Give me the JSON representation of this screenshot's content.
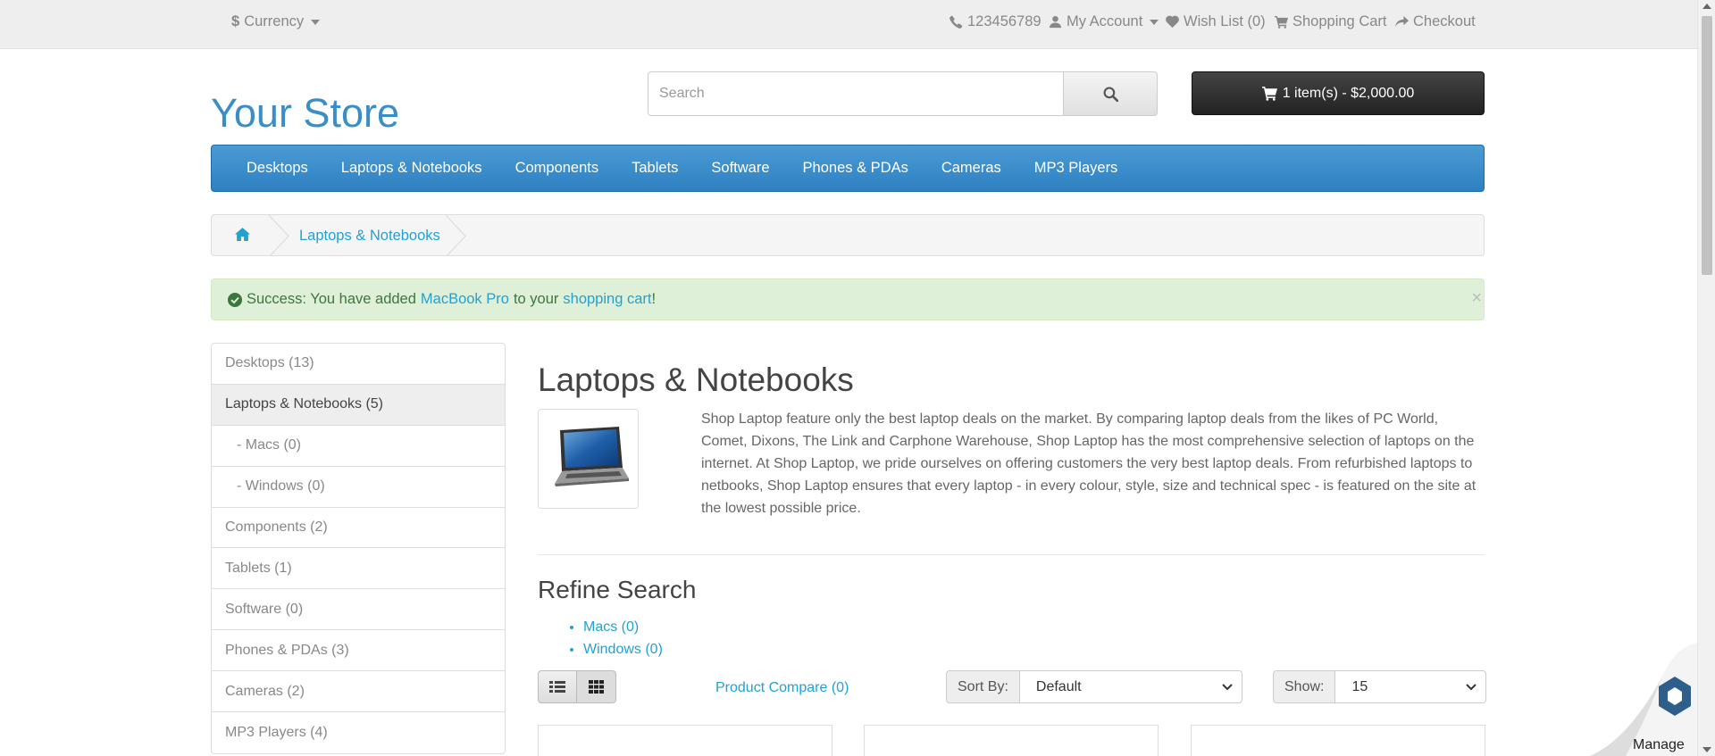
{
  "topbar": {
    "currency": "Currency",
    "phone": "123456789",
    "my_account": "My Account",
    "wish_list": "Wish List (0)",
    "shopping_cart": "Shopping Cart",
    "checkout": "Checkout"
  },
  "header": {
    "logo": "Your Store",
    "search_placeholder": "Search",
    "cart_button": "1 item(s) - $2,000.00"
  },
  "menu": [
    "Desktops",
    "Laptops & Notebooks",
    "Components",
    "Tablets",
    "Software",
    "Phones & PDAs",
    "Cameras",
    "MP3 Players"
  ],
  "breadcrumb": {
    "current": "Laptops & Notebooks"
  },
  "alert": {
    "prefix": "Success: You have added",
    "product": "MacBook Pro",
    "middle": "to your",
    "link": "shopping cart",
    "suffix": "!",
    "close": "×"
  },
  "sidebar": [
    {
      "label": "Desktops (13)"
    },
    {
      "label": "Laptops & Notebooks (5)"
    },
    {
      "label": "- Macs (0)"
    },
    {
      "label": "- Windows (0)"
    },
    {
      "label": "Components (2)"
    },
    {
      "label": "Tablets (1)"
    },
    {
      "label": "Software (0)"
    },
    {
      "label": "Phones & PDAs (3)"
    },
    {
      "label": "Cameras (2)"
    },
    {
      "label": "MP3 Players (4)"
    }
  ],
  "content": {
    "title": "Laptops & Notebooks",
    "description": "Shop Laptop feature only the best laptop deals on the market. By comparing laptop deals from the likes of PC World, Comet, Dixons, The Link and Carphone Warehouse, Shop Laptop has the most comprehensive selection of laptops on the internet. At Shop Laptop, we pride ourselves on offering customers the very best laptop deals. From refurbished laptops to netbooks, Shop Laptop ensures that every laptop - in every colour, style, size and technical spec - is featured on the site at the lowest possible price.",
    "refine_title": "Refine Search",
    "refine_links": [
      "Macs (0)",
      "Windows (0)"
    ],
    "product_compare": "Product Compare (0)",
    "sort_label": "Sort By:",
    "sort_value": "Default",
    "show_label": "Show:",
    "show_value": "15"
  },
  "widget": {
    "manage": "Manage"
  },
  "colors": {
    "accent": "#23a1d1",
    "menu": "#3a8ec7",
    "success_bg": "#dff0d8"
  }
}
